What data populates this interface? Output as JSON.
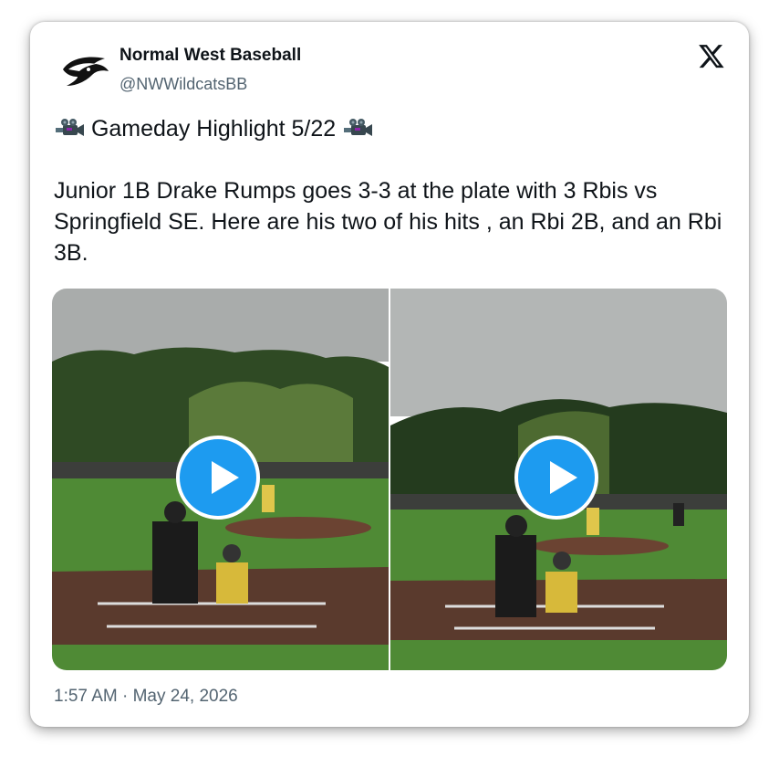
{
  "account": {
    "name": "Normal West Baseball",
    "handle": "@NWWildcatsBB",
    "logo_icon": "wildcat-logo-icon"
  },
  "platform_icon": "x-logo-icon",
  "tweet": {
    "line1": "Gameday Highlight 5/22",
    "line1_icons": [
      "movie-camera-icon",
      "movie-camera-icon"
    ],
    "body": "Junior 1B Drake Rumps goes 3-3 at the plate with 3 Rbis vs Springfield SE. Here are his two of his hits , an Rbi 2B, and an Rbi 3B."
  },
  "media": [
    {
      "type": "video",
      "icon": "play-icon"
    },
    {
      "type": "video",
      "icon": "play-icon"
    }
  ],
  "timestamp": "1:57 AM · May 24, 2026",
  "colors": {
    "accent": "#1d9bf0",
    "text": "#0f1419",
    "secondary": "#536471"
  }
}
